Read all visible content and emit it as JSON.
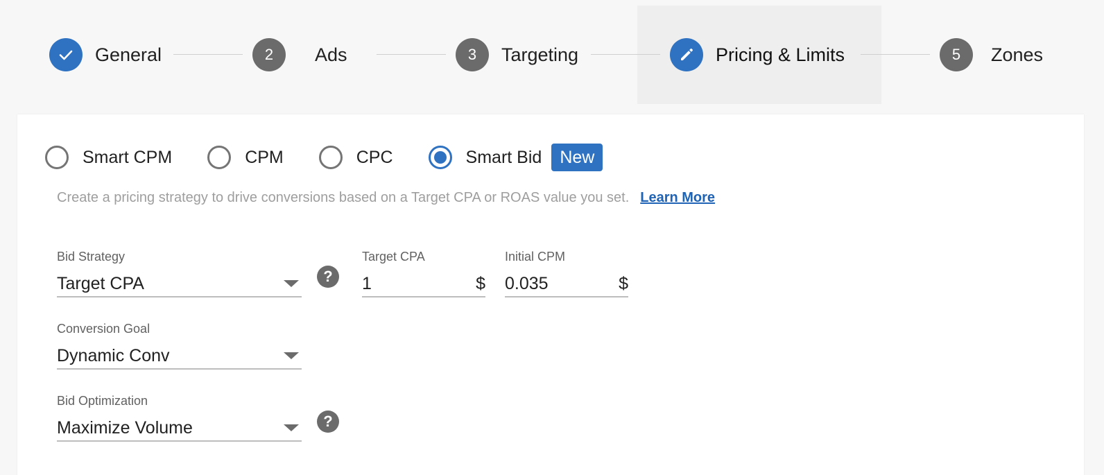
{
  "stepper": {
    "steps": [
      {
        "marker": "✓",
        "label": "General",
        "state": "done"
      },
      {
        "marker": "2",
        "label": "Ads",
        "state": "pending"
      },
      {
        "marker": "3",
        "label": "Targeting",
        "state": "pending"
      },
      {
        "marker": "✎",
        "label": "Pricing & Limits",
        "state": "editing"
      },
      {
        "marker": "5",
        "label": "Zones",
        "state": "pending"
      }
    ]
  },
  "pricing": {
    "options": [
      {
        "label": "Smart CPM",
        "checked": false
      },
      {
        "label": "CPM",
        "checked": false
      },
      {
        "label": "CPC",
        "checked": false
      },
      {
        "label": "Smart Bid",
        "checked": true
      }
    ],
    "new_badge": "New",
    "description": "Create a pricing strategy to drive conversions based on a Target CPA or ROAS value you set.",
    "learn_more": "Learn More"
  },
  "fields": {
    "bid_strategy": {
      "label": "Bid Strategy",
      "value": "Target CPA"
    },
    "target_cpa": {
      "label": "Target CPA",
      "value": "1",
      "suffix": "$"
    },
    "initial_cpm": {
      "label": "Initial CPM",
      "value": "0.035",
      "suffix": "$"
    },
    "conversion_goal": {
      "label": "Conversion Goal",
      "value": "Dynamic Conv"
    },
    "bid_optimization": {
      "label": "Bid Optimization",
      "value": "Maximize Volume"
    }
  },
  "icons": {
    "help": "?",
    "accent_color": "#2f72c1",
    "pending_color": "#6b6b6b"
  }
}
